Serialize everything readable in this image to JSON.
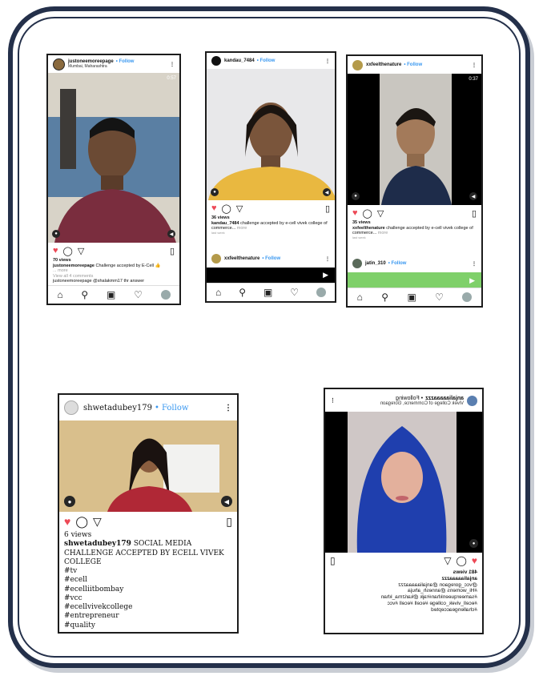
{
  "posts": [
    {
      "username": "justoneemoreepage",
      "follow": "• Follow",
      "location": "Mumbai, Maharashtra",
      "timer": "0:57",
      "views": "70 views",
      "caption_user": "justoneemoreepage",
      "caption": "Challenge accepted by E-Cell",
      "caption_more": "... more",
      "comments": "View all 4 comments",
      "comment_preview": "justoneemoreepage @shalakmm17 thr answer",
      "colors": {
        "like": "#ed4956",
        "link": "#3897f0"
      }
    },
    {
      "username": "kandau_7484",
      "follow": "• Follow",
      "views": "36 views",
      "caption_user": "kandau_7484",
      "caption": "challenge accepted by e-cell vivek college of commerce...",
      "caption_more": "more",
      "time_ago": "last week",
      "next_user": "xxfeelthenature",
      "next_follow": "• Follow"
    },
    {
      "username": "xxfeelthenature",
      "follow": "• Follow",
      "timer": "0:37",
      "views": "35 views",
      "caption_user": "xxfeelthenature",
      "caption": "challenge accepted by e-cell vivek college of commerce...",
      "caption_more": "more",
      "time_ago": "last week",
      "next_user": "jatin_310",
      "next_follow": "• Follow"
    },
    {
      "username": "shwetadubey179",
      "follow": "• Follow",
      "views": "6 views",
      "caption_user": "shwetadubey179",
      "caption": "SOCIAL MEDIA CHALLENGE ACCEPTED BY ECELL VIVEK COLLEGE",
      "hashtags": [
        "#tv",
        "#ecell",
        "#ecelliitbombay",
        "#vcc",
        "#ecellvivekcollege",
        "#entrepreneur",
        "#quality"
      ]
    },
    {
      "username": "anjaliaaaaazzz",
      "follow": "• Following",
      "subline": "Vivek College of Commerce, Goregaon",
      "views": "481 views",
      "caption_user": "anjaliaaaaazzz",
      "caption_lines": [
        "@vcc_goregaon @anjaliaaaaazzz",
        "#Hi_womens @annesh_ahuja",
        "#sameerqueenkhan#rajk @karizma_khan",
        "#ecell_vivek_college #ecell #ecell #vcc",
        "#challengeaccepted"
      ]
    }
  ]
}
